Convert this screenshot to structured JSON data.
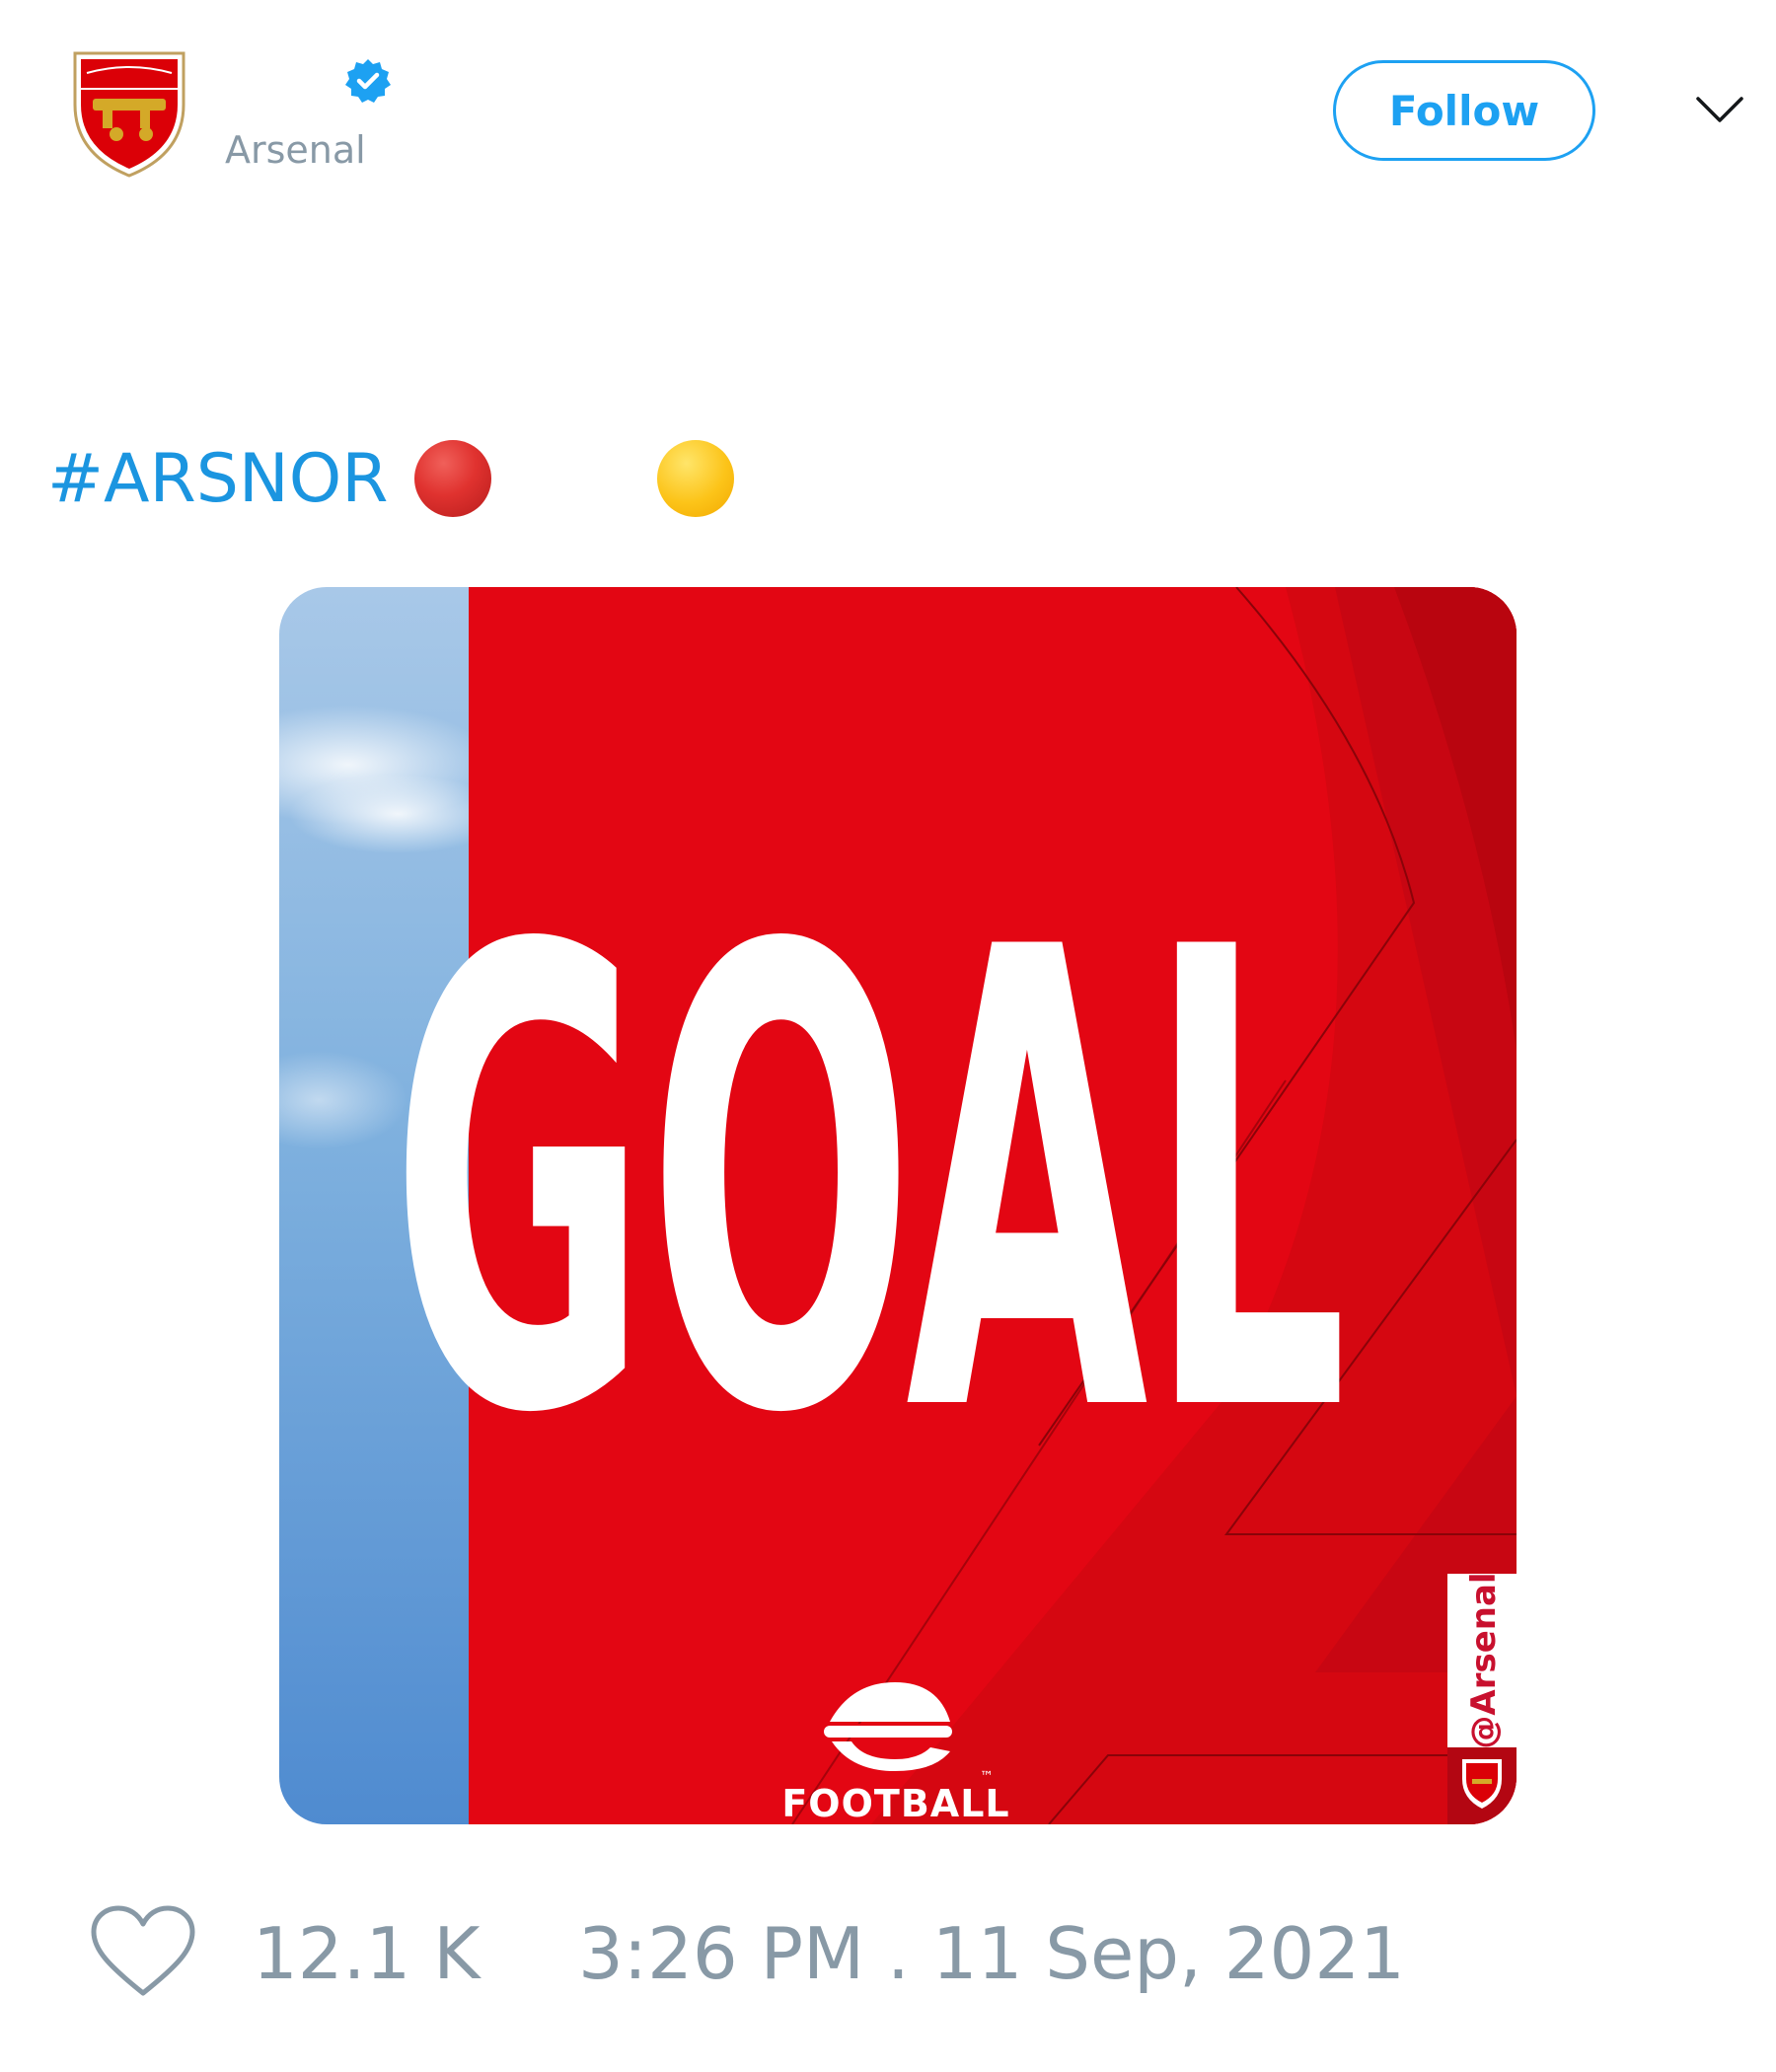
{
  "header": {
    "account_name": "",
    "handle": "Arsenal",
    "verified": true,
    "follow_label": "Follow",
    "menu_icon": "chevron-down-icon",
    "avatar_icon": "arsenal-crest-icon"
  },
  "tweet": {
    "hashtag": "#ARSNOR",
    "emojis": [
      "red-circle",
      "yellow-circle"
    ]
  },
  "media": {
    "headline": "GOAL",
    "sponsor": "FOOTBALL",
    "sponsor_tm": "™",
    "watermark": "@Arsenal",
    "colors": {
      "red": "#e30613",
      "dark_red": "#c80612",
      "sky": "#6fa8dc"
    }
  },
  "footer": {
    "like_count": "12.1 K",
    "timestamp": "3:26 PM . 11 Sep, 2021"
  },
  "colors": {
    "accent": "#1da1f2",
    "muted": "#8899a6"
  }
}
